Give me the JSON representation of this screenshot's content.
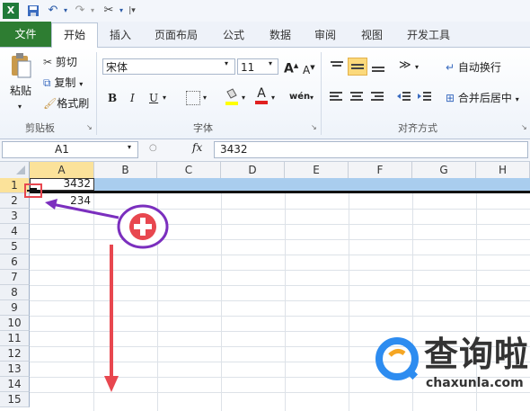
{
  "qat": {
    "icons": [
      "excel-logo-icon",
      "save-icon",
      "undo-icon",
      "redo-icon",
      "customize-icon"
    ]
  },
  "tabs": [
    "文件",
    "开始",
    "插入",
    "页面布局",
    "公式",
    "数据",
    "审阅",
    "视图",
    "开发工具"
  ],
  "clipboard": {
    "paste": "粘贴",
    "cut": "剪切",
    "copy": "复制",
    "format_painter": "格式刷",
    "group": "剪贴板"
  },
  "font": {
    "name": "宋体",
    "size": "11",
    "bold": "B",
    "italic": "I",
    "underline": "U",
    "phonetic": "wén",
    "color_a": "A",
    "group": "字体"
  },
  "alignment": {
    "wrap_text": "自动换行",
    "merge_center": "合并后居中",
    "group": "对齐方式"
  },
  "formula_bar": {
    "name_box": "A1",
    "fx": "fx",
    "value": "3432"
  },
  "columns": [
    "A",
    "B",
    "C",
    "D",
    "E",
    "F",
    "G",
    "H"
  ],
  "rows": [
    "1",
    "2",
    "3",
    "4",
    "5",
    "6",
    "7",
    "8",
    "9",
    "10",
    "11",
    "12",
    "13",
    "14",
    "15"
  ],
  "cells": {
    "A1": "3432",
    "A2": "234"
  },
  "watermark": {
    "brand": "查询啦",
    "url": "chaxunla.com"
  },
  "colors": {
    "file_tab": "#2e7d32",
    "selection": "#fbe29a",
    "row_highlight": "#a9cdee",
    "annotation": "#7b2fbe",
    "arrow": "#e8474f"
  }
}
